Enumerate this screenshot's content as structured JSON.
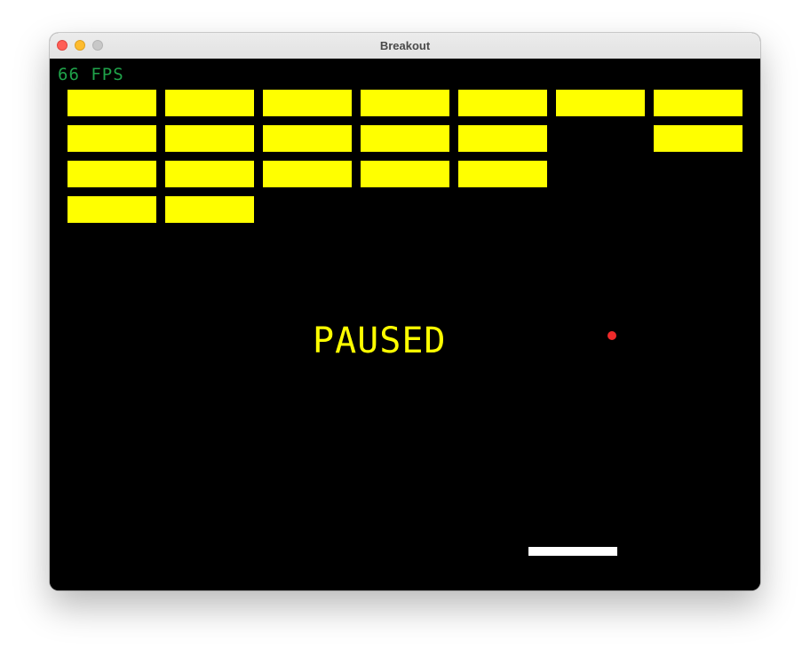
{
  "window": {
    "title": "Breakout",
    "controls": [
      "close-button",
      "minimize-button",
      "zoom-button"
    ]
  },
  "hud": {
    "fps": "66 FPS"
  },
  "status": {
    "message": "PAUSED"
  },
  "colors": {
    "brick": "#ffff00",
    "fps_text": "#1fa34a",
    "paused_text": "#ffff00",
    "ball": "#ee2a2a",
    "paddle": "#ffffff",
    "background": "#000000"
  },
  "bricks": {
    "rows": 4,
    "columns": 7,
    "grid": [
      [
        true,
        true,
        true,
        true,
        true,
        true,
        true
      ],
      [
        true,
        true,
        true,
        true,
        true,
        false,
        true
      ],
      [
        true,
        true,
        true,
        true,
        true,
        false,
        false
      ],
      [
        true,
        true,
        false,
        false,
        false,
        false,
        false
      ]
    ]
  }
}
